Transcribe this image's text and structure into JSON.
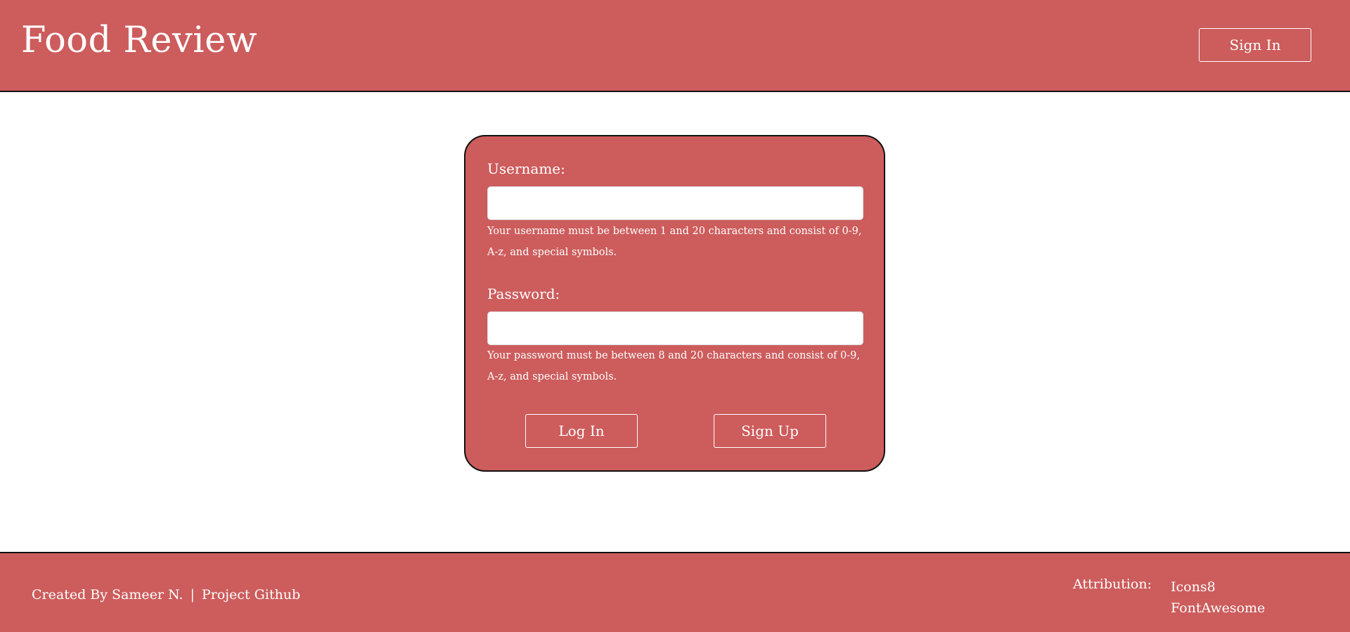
{
  "header": {
    "title": "Food Review",
    "sign_in_label": "Sign In"
  },
  "login_form": {
    "username": {
      "label": "Username:",
      "value": "",
      "placeholder": "",
      "hint": "Your username must be between 1 and 20 characters and consist of 0-9, A-z, and special symbols."
    },
    "password": {
      "label": "Password:",
      "value": "",
      "placeholder": "",
      "hint": "Your password must be between 8 and 20 characters and consist of 0-9, A-z, and special symbols."
    },
    "log_in_label": "Log In",
    "sign_up_label": "Sign Up"
  },
  "footer": {
    "created_by": "Created By Sameer N.",
    "separator": "|",
    "github_link": "Project Github",
    "attribution_label": "Attribution:",
    "attributions": [
      "Icons8",
      "FontAwesome"
    ]
  },
  "colors": {
    "brand": "#cd5c5c",
    "background": "#ffffff",
    "text_on_brand": "#ffffff",
    "border": "#111111"
  }
}
